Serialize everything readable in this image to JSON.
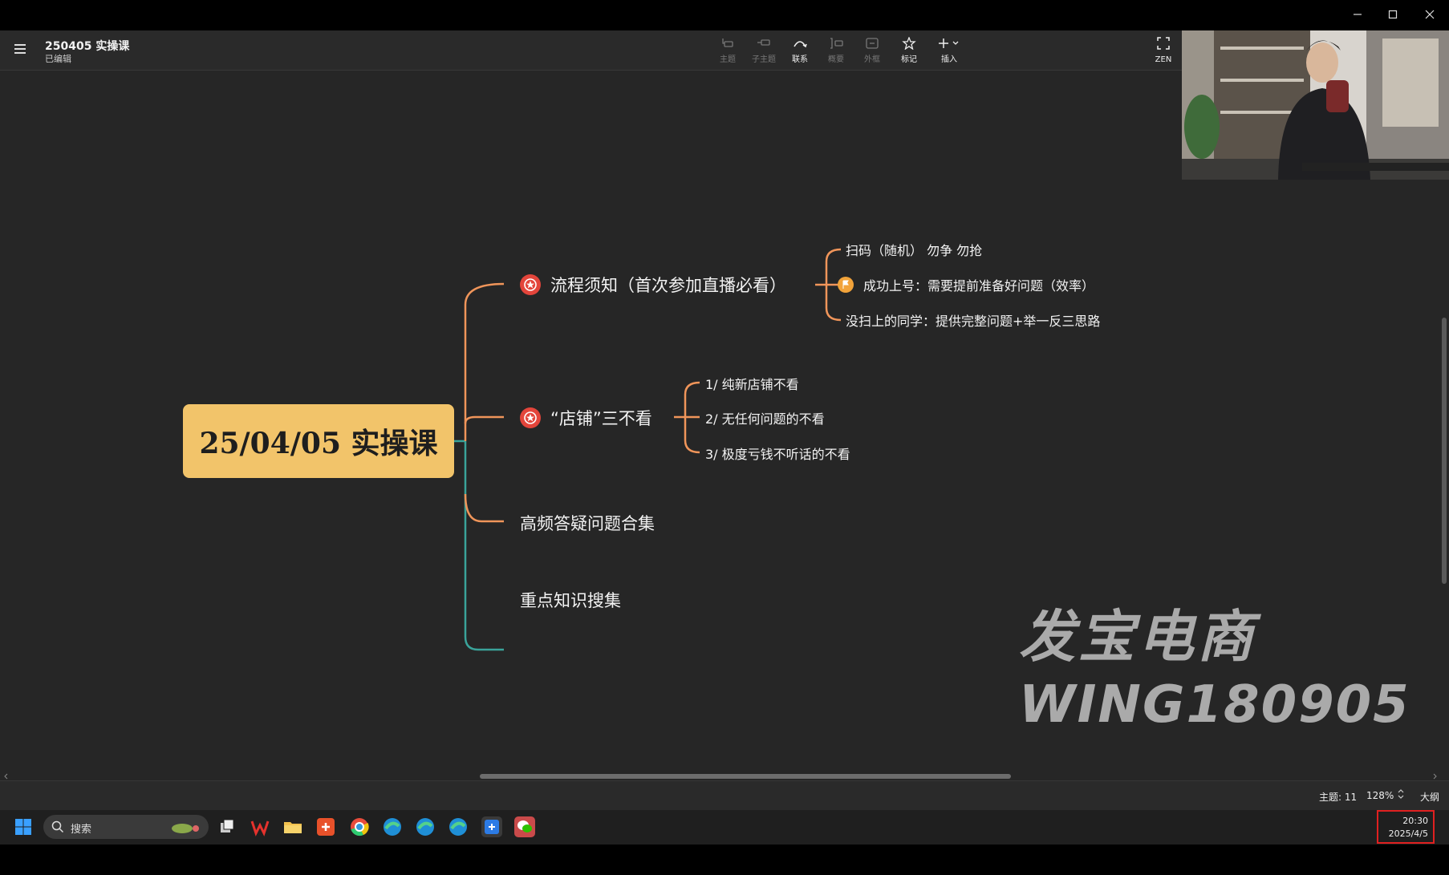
{
  "window": {
    "minimize": "—",
    "maximize": "☐",
    "close": "✕"
  },
  "app": {
    "doc_title": "250405 实操课",
    "doc_status": "已编辑",
    "toolbar": [
      {
        "id": "topic",
        "label": "主题",
        "icon": "topic-icon",
        "enabled": false
      },
      {
        "id": "subtopic",
        "label": "子主题",
        "icon": "subtopic-icon",
        "enabled": false
      },
      {
        "id": "relationship",
        "label": "联系",
        "icon": "relationship-icon",
        "enabled": true
      },
      {
        "id": "summary",
        "label": "概要",
        "icon": "summary-icon",
        "enabled": false
      },
      {
        "id": "boundary",
        "label": "外框",
        "icon": "boundary-icon",
        "enabled": false
      },
      {
        "id": "marker",
        "label": "标记",
        "icon": "star-icon",
        "enabled": true
      },
      {
        "id": "insert",
        "label": "插入",
        "icon": "plus-icon",
        "enabled": true
      }
    ],
    "zen_label": "ZEN"
  },
  "mindmap": {
    "root": "25/04/05 实操课",
    "branches": [
      {
        "label": "流程须知（首次参加直播必看）",
        "marker": "star",
        "children": [
          {
            "label": "扫码（随机） 勿争 勿抢"
          },
          {
            "label": "成功上号：需要提前准备好问题（效率）",
            "marker": "flag"
          },
          {
            "label": "没扫上的同学：提供完整问题+举一反三思路"
          }
        ]
      },
      {
        "label": "“店铺”三不看",
        "marker": "star",
        "children": [
          {
            "label": "1/ 纯新店铺不看"
          },
          {
            "label": "2/ 无任何问题的不看"
          },
          {
            "label": "3/ 极度亏钱不听话的不看"
          }
        ]
      },
      {
        "label": "高频答疑问题合集"
      },
      {
        "label": "重点知识搜集"
      }
    ],
    "colors": {
      "orange": "#f0955a",
      "teal": "#3aa39a",
      "root_fill": "#f2c46a"
    }
  },
  "statusbar": {
    "topic_count": "主题: 11",
    "zoom": "128%",
    "outline": "大纲"
  },
  "watermark": {
    "line1": "发宝电商",
    "line2": "WING180905"
  },
  "taskbar": {
    "search_placeholder": "搜索",
    "clock_time": "20:30",
    "clock_date": "2025/4/5"
  }
}
